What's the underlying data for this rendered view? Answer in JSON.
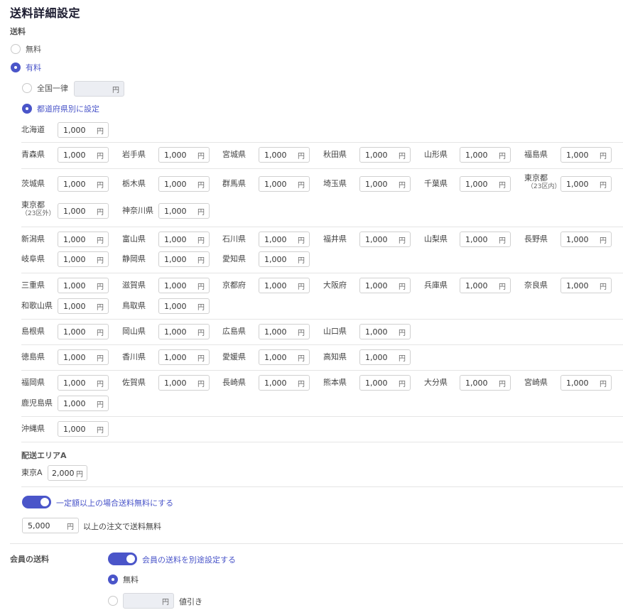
{
  "title": "送料詳細設定",
  "shipping": {
    "label": "送料",
    "free_label": "無料",
    "paid_label": "有料",
    "flat_label": "全国一律",
    "flat_unit": "円",
    "by_pref_label": "都道府県別に設定"
  },
  "currency_unit": "円",
  "prefectures": {
    "hokkaido": {
      "name": "北海道",
      "value": "1,000"
    },
    "aomori": {
      "name": "青森県",
      "value": "1,000"
    },
    "iwate": {
      "name": "岩手県",
      "value": "1,000"
    },
    "miyagi": {
      "name": "宮城県",
      "value": "1,000"
    },
    "akita": {
      "name": "秋田県",
      "value": "1,000"
    },
    "yamagata": {
      "name": "山形県",
      "value": "1,000"
    },
    "fukushima": {
      "name": "福島県",
      "value": "1,000"
    },
    "ibaraki": {
      "name": "茨城県",
      "value": "1,000"
    },
    "tochigi": {
      "name": "栃木県",
      "value": "1,000"
    },
    "gunma": {
      "name": "群馬県",
      "value": "1,000"
    },
    "saitama": {
      "name": "埼玉県",
      "value": "1,000"
    },
    "chiba": {
      "name": "千葉県",
      "value": "1,000"
    },
    "tokyo_in": {
      "name": "東京都",
      "sub": "（23区内）",
      "value": "1,000"
    },
    "tokyo_out": {
      "name": "東京都",
      "sub": "（23区外）",
      "value": "1,000"
    },
    "kanagawa": {
      "name": "神奈川県",
      "value": "1,000"
    },
    "niigata": {
      "name": "新潟県",
      "value": "1,000"
    },
    "toyama": {
      "name": "富山県",
      "value": "1,000"
    },
    "ishikawa": {
      "name": "石川県",
      "value": "1,000"
    },
    "fukui": {
      "name": "福井県",
      "value": "1,000"
    },
    "yamanashi": {
      "name": "山梨県",
      "value": "1,000"
    },
    "nagano": {
      "name": "長野県",
      "value": "1,000"
    },
    "gifu": {
      "name": "岐阜県",
      "value": "1,000"
    },
    "shizuoka": {
      "name": "静岡県",
      "value": "1,000"
    },
    "aichi": {
      "name": "愛知県",
      "value": "1,000"
    },
    "mie": {
      "name": "三重県",
      "value": "1,000"
    },
    "shiga": {
      "name": "滋賀県",
      "value": "1,000"
    },
    "kyoto": {
      "name": "京都府",
      "value": "1,000"
    },
    "osaka": {
      "name": "大阪府",
      "value": "1,000"
    },
    "hyogo": {
      "name": "兵庫県",
      "value": "1,000"
    },
    "nara": {
      "name": "奈良県",
      "value": "1,000"
    },
    "wakayama": {
      "name": "和歌山県",
      "value": "1,000"
    },
    "tottori": {
      "name": "鳥取県",
      "value": "1,000"
    },
    "shimane": {
      "name": "島根県",
      "value": "1,000"
    },
    "okayama": {
      "name": "岡山県",
      "value": "1,000"
    },
    "hiroshima": {
      "name": "広島県",
      "value": "1,000"
    },
    "yamaguchi": {
      "name": "山口県",
      "value": "1,000"
    },
    "tokushima": {
      "name": "徳島県",
      "value": "1,000"
    },
    "kagawa": {
      "name": "香川県",
      "value": "1,000"
    },
    "ehime": {
      "name": "愛媛県",
      "value": "1,000"
    },
    "kochi": {
      "name": "高知県",
      "value": "1,000"
    },
    "fukuoka": {
      "name": "福岡県",
      "value": "1,000"
    },
    "saga": {
      "name": "佐賀県",
      "value": "1,000"
    },
    "nagasaki": {
      "name": "長崎県",
      "value": "1,000"
    },
    "kumamoto": {
      "name": "熊本県",
      "value": "1,000"
    },
    "oita": {
      "name": "大分県",
      "value": "1,000"
    },
    "miyazaki": {
      "name": "宮崎県",
      "value": "1,000"
    },
    "kagoshima": {
      "name": "鹿児島県",
      "value": "1,000"
    },
    "okinawa": {
      "name": "沖縄県",
      "value": "1,000"
    }
  },
  "area": {
    "heading": "配送エリアA",
    "tokyo_a_name": "東京A",
    "tokyo_a_value": "2,000"
  },
  "free_threshold": {
    "toggle_label": "一定額以上の場合送料無料にする",
    "value": "5,000",
    "suffix": "以上の注文で送料無料"
  },
  "member": {
    "label": "会員の送料",
    "toggle_label": "会員の送料を別途設定する",
    "free_label": "無料",
    "discount_suffix": "値引き"
  },
  "colors": {
    "accent": "#4a55c9"
  }
}
